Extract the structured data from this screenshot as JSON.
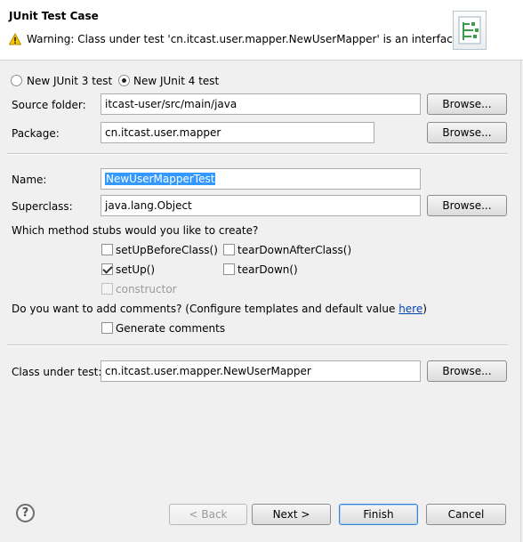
{
  "header": {
    "title": "JUnit Test Case",
    "warning_text": "Warning: Class under test 'cn.itcast.user.mapper.NewUserMapper' is an interface.",
    "warning_icon": "warning-icon",
    "wizard_icon": "junit-wizard-banner-icon"
  },
  "version": {
    "junit3_label": "New JUnit 3 test",
    "junit4_label": "New JUnit 4 test",
    "selected": "junit4"
  },
  "source_folder": {
    "label": "Source folder:",
    "value": "itcast-user/src/main/java",
    "browse": "Browse..."
  },
  "package": {
    "label": "Package:",
    "value": "cn.itcast.user.mapper",
    "browse": "Browse..."
  },
  "name": {
    "label": "Name:",
    "value": "NewUserMapperTest"
  },
  "superclass": {
    "label": "Superclass:",
    "value": "java.lang.Object",
    "browse": "Browse..."
  },
  "stubs": {
    "question": "Which method stubs would you like to create?",
    "setUpBeforeClass": {
      "label": "setUpBeforeClass()",
      "checked": false
    },
    "tearDownAfterClass": {
      "label": "tearDownAfterClass()",
      "checked": false
    },
    "setUp": {
      "label": "setUp()",
      "checked": true
    },
    "tearDown": {
      "label": "tearDown()",
      "checked": false
    },
    "constructor": {
      "label": "constructor",
      "checked": false,
      "enabled": false
    }
  },
  "comments": {
    "question": "Do you want to add comments? (Configure templates and default value ",
    "link": "here",
    "closing": ")",
    "generate_label": "Generate comments",
    "checked": false
  },
  "class_under_test": {
    "label": "Class under test:",
    "value": "cn.itcast.user.mapper.NewUserMapper",
    "browse": "Browse..."
  },
  "footer": {
    "help_glyph": "?",
    "back": "< Back",
    "next": "Next >",
    "finish": "Finish",
    "cancel": "Cancel"
  }
}
